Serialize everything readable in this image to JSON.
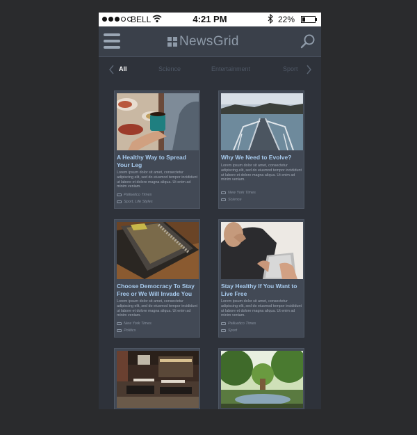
{
  "status_bar": {
    "carrier": "BELL",
    "time": "4:21 PM",
    "battery_percent": "22%",
    "battery_level": 0.22,
    "signal_bars_filled": 3,
    "signal_bars_total": 5
  },
  "header": {
    "app_title": "NewsGrid",
    "menu_icon": "hamburger-icon",
    "search_icon": "search-icon"
  },
  "category_tabs": {
    "items": [
      "All",
      "Science",
      "Entertainment",
      "Sport"
    ],
    "active": "All"
  },
  "articles": [
    {
      "title": "A Healthy Way to Spread Your Leg",
      "excerpt": "Lorem ipsum dolor sit amet, consectetur adipiscing elit, sed do eiusmod tempor incididunt ut labore et dolore magna aliqua. Ut enim ad minim veniam.",
      "source": "Palluetico Times",
      "tags": "Sport, Life Styles"
    },
    {
      "title": "Why We Need to Evolve?",
      "excerpt": "Lorem ipsum dolor sit amet, consectetur adipiscing elit, sed do eiusmod tempor incididunt ut labore et dolore magna aliqua. Ut enim ad minim veniam.",
      "source": "New York Times",
      "tags": "Science"
    },
    {
      "title": "Choose Democracy To Stay Free or We Will Invade You",
      "excerpt": "Lorem ipsum dolor sit amet, consectetur adipiscing elit, sed do eiusmod tempor incididunt ut labore et dolore magna aliqua. Ut enim ad minim veniam.",
      "source": "New York Times",
      "tags": "Politics"
    },
    {
      "title": "Stay Healthy If You Want to Live Free",
      "excerpt": "Lorem ipsum dolor sit amet, consectetur adipiscing elit, sed do eiusmod tempor incididunt ut labore et dolore magna aliqua. Ut enim ad minim veniam.",
      "source": "Palluetico Times",
      "tags": "Sport"
    },
    {
      "title": "",
      "excerpt": "",
      "source": "",
      "tags": ""
    },
    {
      "title": "",
      "excerpt": "",
      "source": "",
      "tags": ""
    }
  ],
  "colors": {
    "background": "#2a2b2d",
    "app_background": "#2e323a",
    "navbar": "#3a404a",
    "card": "#424955",
    "title_accent": "#a8cbee",
    "muted_text": "#a0a8b4"
  }
}
